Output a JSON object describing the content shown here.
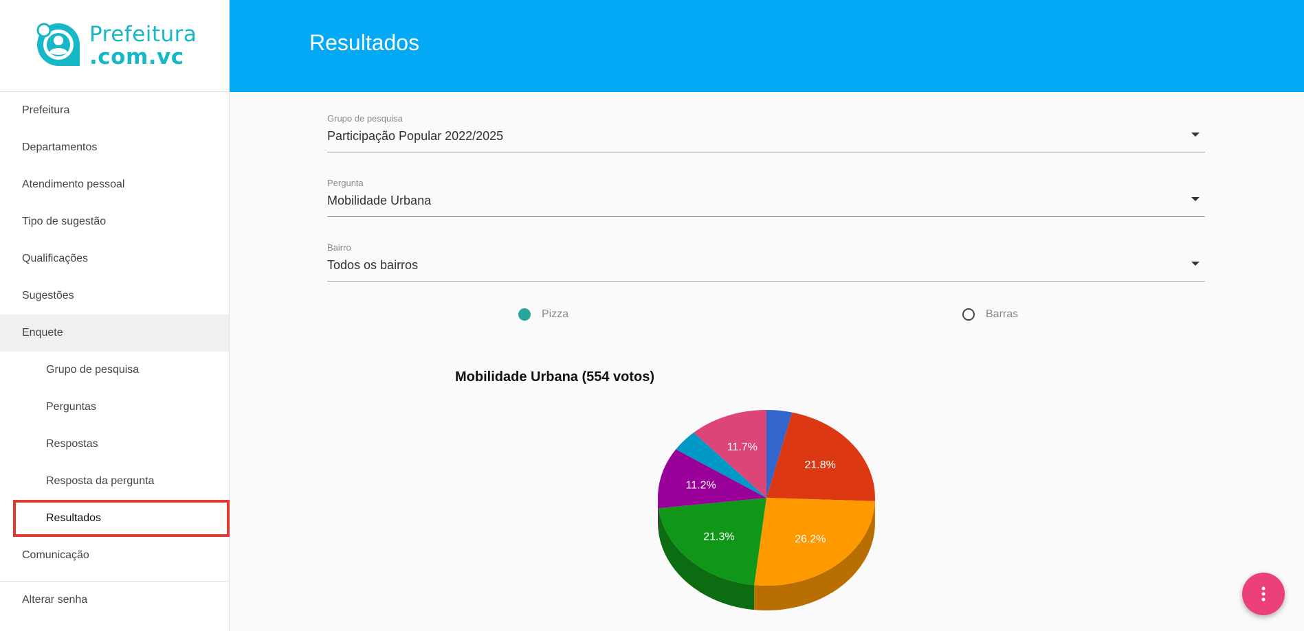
{
  "brand": {
    "line1": "Prefeitura",
    "line2": ".com.vc"
  },
  "header": {
    "title": "Resultados"
  },
  "sidebar": {
    "items": [
      {
        "label": "Prefeitura"
      },
      {
        "label": "Departamentos"
      },
      {
        "label": "Atendimento pessoal"
      },
      {
        "label": "Tipo de sugestão"
      },
      {
        "label": "Qualificações"
      },
      {
        "label": "Sugestões"
      },
      {
        "label": "Enquete"
      },
      {
        "label": "Grupo de pesquisa"
      },
      {
        "label": "Perguntas"
      },
      {
        "label": "Respostas"
      },
      {
        "label": "Resposta da pergunta"
      },
      {
        "label": "Resultados"
      },
      {
        "label": "Comunicação"
      }
    ],
    "bottom": {
      "label": "Alterar senha"
    }
  },
  "form": {
    "grupo": {
      "label": "Grupo de pesquisa",
      "value": "Participação Popular 2022/2025"
    },
    "pergunta": {
      "label": "Pergunta",
      "value": "Mobilidade Urbana"
    },
    "bairro": {
      "label": "Bairro",
      "value": "Todos os bairros"
    },
    "chart_type": {
      "option1": "Pizza",
      "option2": "Barras",
      "selected": "Pizza"
    }
  },
  "colors": {
    "accent": "#03a9f4",
    "brand": "#16b8c8",
    "fab": "#ec407a",
    "highlight": "#e03b2f"
  },
  "chart_data": {
    "type": "pie",
    "title": "Mobilidade Urbana (554 votos)",
    "series": [
      {
        "value": 3.8,
        "label": "",
        "color": "#3366cc"
      },
      {
        "value": 21.8,
        "label": "21.8%",
        "color": "#dc3912"
      },
      {
        "value": 26.2,
        "label": "26.2%",
        "color": "#ff9900"
      },
      {
        "value": 21.3,
        "label": "21.3%",
        "color": "#109618"
      },
      {
        "value": 11.2,
        "label": "11.2%",
        "color": "#990099"
      },
      {
        "value": 4.0,
        "label": "",
        "color": "#0099c6"
      },
      {
        "value": 11.7,
        "label": "11.7%",
        "color": "#dd4477"
      }
    ]
  }
}
